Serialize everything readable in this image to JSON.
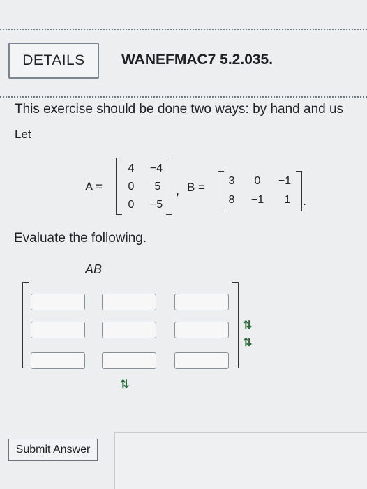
{
  "header": {
    "details_label": "DETAILS",
    "problem_code": "WANEFMAC7 5.2.035."
  },
  "intro_text": "This exercise should be done two ways: by hand and us",
  "let_text": "Let",
  "matrix_a": {
    "label": "A =",
    "rows": [
      [
        "4",
        "−4"
      ],
      [
        "0",
        "5"
      ],
      [
        "0",
        "−5"
      ]
    ]
  },
  "matrix_b": {
    "label": "B =",
    "rows": [
      [
        "3",
        "0",
        "−1"
      ],
      [
        "8",
        "−1",
        "1"
      ]
    ]
  },
  "separator_comma": ",",
  "end_period": ".",
  "evaluate_text": "Evaluate the following.",
  "expression_label": "AB",
  "answer_matrix": {
    "rows": 3,
    "cols": 3,
    "values": [
      [
        "",
        "",
        ""
      ],
      [
        "",
        "",
        ""
      ],
      [
        "",
        "",
        ""
      ]
    ]
  },
  "row_arrows": [
    "⇅",
    "⇅"
  ],
  "col_arrows": "⇅",
  "submit_label": "Submit Answer"
}
